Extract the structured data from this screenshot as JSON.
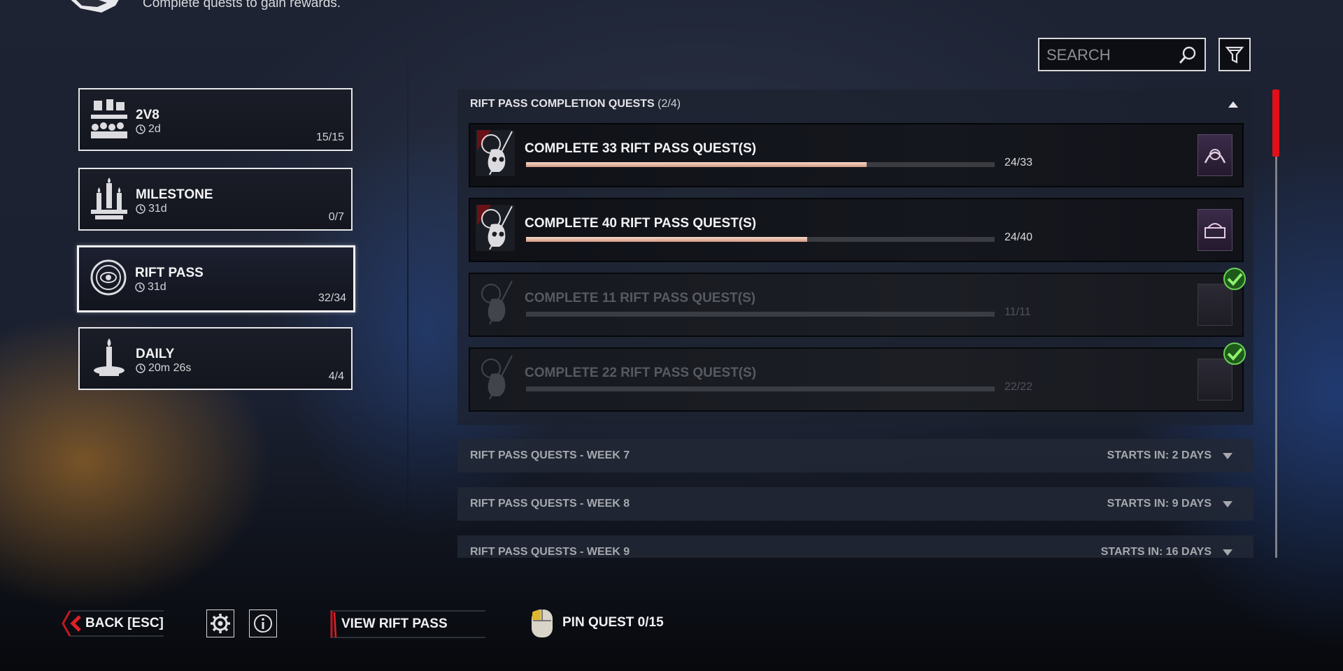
{
  "header": {
    "subtitle": "Complete quests to gain rewards."
  },
  "categories": [
    {
      "title": "2V8",
      "time": "2d",
      "count": "15/15",
      "icon": "horde-icon"
    },
    {
      "title": "MILESTONE",
      "time": "31d",
      "count": "0/7",
      "icon": "candles-icon"
    },
    {
      "title": "RIFT PASS",
      "time": "31d",
      "count": "32/34",
      "icon": "rift-eye-icon",
      "active": true
    },
    {
      "title": "DAILY",
      "time": "20m 26s",
      "count": "4/4",
      "icon": "candle-icon"
    }
  ],
  "search": {
    "placeholder": "SEARCH"
  },
  "section": {
    "title": "RIFT PASS COMPLETION QUESTS",
    "count": "(2/4)"
  },
  "quests": [
    {
      "title": "COMPLETE 33 RIFT PASS QUEST(S)",
      "progress": "24/33",
      "fraction": 0.727,
      "completed": false
    },
    {
      "title": "COMPLETE 40 RIFT PASS QUEST(S)",
      "progress": "24/40",
      "fraction": 0.6,
      "completed": false
    },
    {
      "title": "COMPLETE 11 RIFT PASS QUEST(S)",
      "progress": "11/11",
      "fraction": 1.0,
      "completed": true
    },
    {
      "title": "COMPLETE 22 RIFT PASS QUEST(S)",
      "progress": "22/22",
      "fraction": 1.0,
      "completed": true
    }
  ],
  "weeks": [
    {
      "name": "RIFT PASS QUESTS - WEEK 7",
      "starts": "STARTS IN: 2 DAYS"
    },
    {
      "name": "RIFT PASS QUESTS - WEEK 8",
      "starts": "STARTS IN: 9 DAYS"
    },
    {
      "name": "RIFT PASS QUESTS - WEEK 9",
      "starts": "STARTS IN: 16 DAYS"
    }
  ],
  "footer": {
    "back_label": "BACK [ESC]",
    "view_rift_pass_label": "VIEW RIFT PASS",
    "pin_quest_label": "PIN QUEST 0/15"
  },
  "colors": {
    "scrollbar_thumb": "#e0101a",
    "progress_fill": "#f0c4b0",
    "completed_check": "#49b83a"
  }
}
